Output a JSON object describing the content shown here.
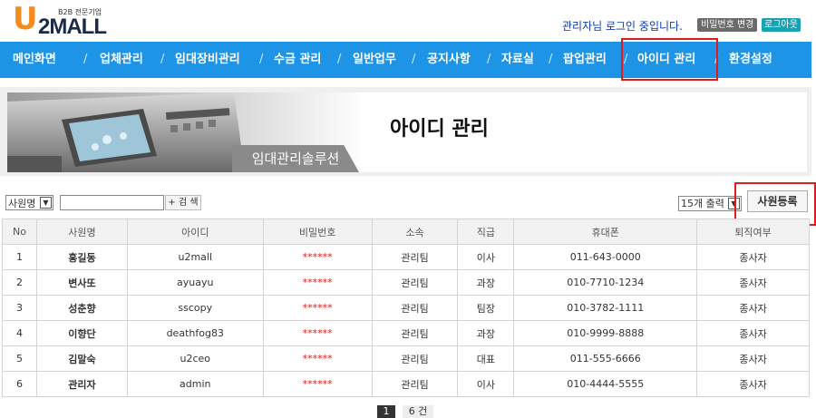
{
  "header": {
    "logo_u": "U",
    "logo_mall": "2MALL",
    "logo_tagline": "B2B 전문기업",
    "login_message": "관리자님 로그인 중입니다.",
    "change_password_label": "비밀번호 변경",
    "logout_label": "로그아웃"
  },
  "nav": {
    "items": [
      "메인화면",
      "업체관리",
      "임대장비관리",
      "수금 관리",
      "일반업무",
      "공지사항",
      "자료실",
      "팝업관리",
      "아이디 관리",
      "환경설정"
    ],
    "separator": "/",
    "active": "아이디 관리"
  },
  "banner": {
    "title": "아이디 관리",
    "tag": "임대관리솔루션"
  },
  "toolbar": {
    "search_field_value": "사원명",
    "search_input_value": "",
    "search_button_label": "+ 검 색",
    "page_size_value": "15개 출력",
    "register_button_label": "사원등록"
  },
  "table": {
    "columns": [
      "No",
      "사원명",
      "아이디",
      "비밀번호",
      "소속",
      "직급",
      "휴대폰",
      "퇴직여부"
    ],
    "rows": [
      [
        "1",
        "홍길동",
        "u2mall",
        "******",
        "관리팀",
        "이사",
        "011-643-0000",
        "종사자"
      ],
      [
        "2",
        "변사또",
        "ayuayu",
        "******",
        "관리팀",
        "과장",
        "010-7710-1234",
        "종사자"
      ],
      [
        "3",
        "성춘향",
        "sscopy",
        "******",
        "관리팀",
        "팀장",
        "010-3782-1111",
        "종사자"
      ],
      [
        "4",
        "이향단",
        "deathfog83",
        "******",
        "관리팀",
        "과장",
        "010-9999-8888",
        "종사자"
      ],
      [
        "5",
        "김말숙",
        "u2ceo",
        "******",
        "관리팀",
        "대표",
        "011-555-6666",
        "종사자"
      ],
      [
        "6",
        "관리자",
        "admin",
        "******",
        "관리팀",
        "이사",
        "010-4444-5555",
        "종사자"
      ]
    ]
  },
  "pagination": {
    "current": "1",
    "total_label": "6 건"
  },
  "colors": {
    "nav_bg": "#1e94e6",
    "highlight": "#e21a1a",
    "password_mask": "#e21a1a"
  }
}
